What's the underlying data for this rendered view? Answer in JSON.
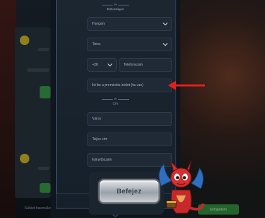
{
  "section_label": "Biztonságos",
  "form": {
    "country": {
      "value": "Hungary"
    },
    "county": {
      "value": "Tolna"
    },
    "dial_code": {
      "value": "+36"
    },
    "phone": {
      "placeholder": "Telefonszám"
    },
    "promo": {
      "placeholder": "Írd be a promóciós kódot (ha van)"
    }
  },
  "address_section": {
    "label": "Cím"
  },
  "address": {
    "city": {
      "placeholder": "Város"
    },
    "full_address": {
      "placeholder": "Teljes cím"
    },
    "zip": {
      "placeholder": "Irányítószám"
    }
  },
  "submit_label": "Befejez",
  "background": {
    "bottom_text": "Sütiket használunk",
    "bottom_button": "Elfogadom"
  },
  "colors": {
    "arrow": "#e02020",
    "panel_border": "#3a4c6b"
  }
}
